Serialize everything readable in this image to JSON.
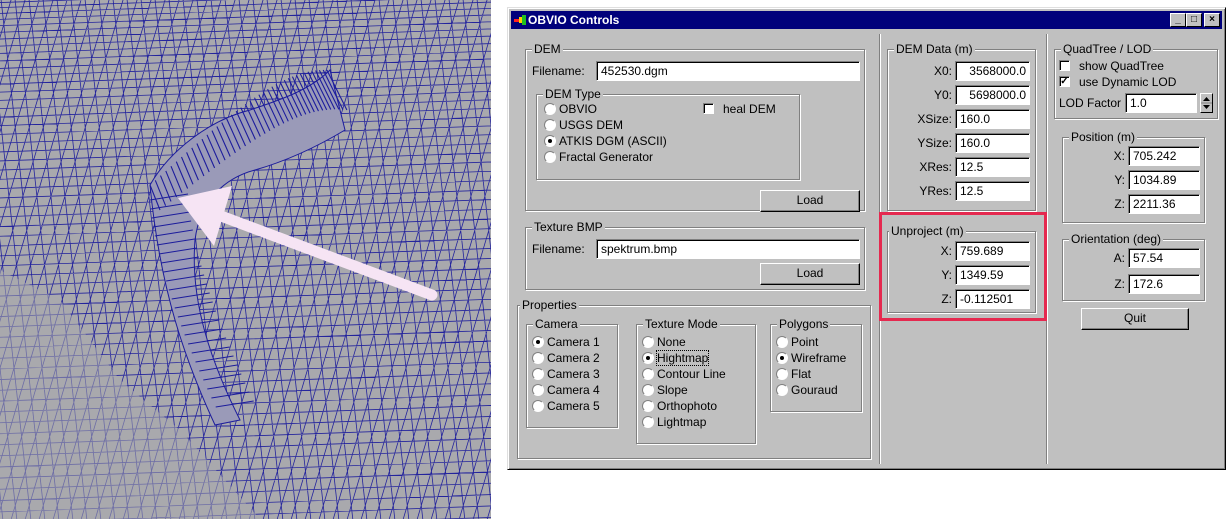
{
  "window": {
    "title": "OBVIO Controls",
    "minimize": "_",
    "maximize": "□",
    "close": "×"
  },
  "dem": {
    "group_label": "DEM",
    "filename_label": "Filename:",
    "filename": "452530.dgm",
    "type_group_label": "DEM Type",
    "types": [
      "OBVIO",
      "USGS DEM",
      "ATKIS DGM (ASCII)",
      "Fractal Generator"
    ],
    "selected_type": "ATKIS DGM (ASCII)",
    "heal_label": "heal DEM",
    "heal_checked": false,
    "load_label": "Load"
  },
  "texture": {
    "group_label": "Texture BMP",
    "filename_label": "Filename:",
    "filename": "spektrum.bmp",
    "load_label": "Load"
  },
  "properties": {
    "group_label": "Properties",
    "camera": {
      "label": "Camera",
      "options": [
        "Camera 1",
        "Camera 2",
        "Camera 3",
        "Camera 4",
        "Camera 5"
      ],
      "selected": "Camera 1"
    },
    "texture_mode": {
      "label": "Texture Mode",
      "options": [
        "None",
        "Hightmap",
        "Contour Line",
        "Slope",
        "Orthophoto",
        "Lightmap"
      ],
      "selected": "Hightmap"
    },
    "polygons": {
      "label": "Polygons",
      "options": [
        "Point",
        "Wireframe",
        "Flat",
        "Gouraud"
      ],
      "selected": "Wireframe"
    }
  },
  "dem_data": {
    "group_label": "DEM Data (m)",
    "fields": [
      {
        "label": "X0:",
        "value": "3568000.0"
      },
      {
        "label": "Y0:",
        "value": "5698000.0"
      },
      {
        "label": "XSize:",
        "value": "160.0"
      },
      {
        "label": "YSize:",
        "value": "160.0"
      },
      {
        "label": "XRes:",
        "value": "12.5"
      },
      {
        "label": "YRes:",
        "value": "12.5"
      }
    ]
  },
  "unproject": {
    "group_label": "Unproject (m)",
    "fields": [
      {
        "label": "X:",
        "value": "759.689"
      },
      {
        "label": "Y:",
        "value": "1349.59"
      },
      {
        "label": "Z:",
        "value": "-0.112501"
      }
    ],
    "highlight_color": "#e5294f"
  },
  "quadtree": {
    "group_label": "QuadTree / LOD",
    "show_label": "show QuadTree",
    "show_checked": false,
    "dynamic_label": "use Dynamic LOD",
    "dynamic_checked": true,
    "lod_label": "LOD Factor",
    "lod_value": "1.0"
  },
  "position": {
    "group_label": "Position (m)",
    "fields": [
      {
        "label": "X:",
        "value": "705.242"
      },
      {
        "label": "Y:",
        "value": "1034.89"
      },
      {
        "label": "Z:",
        "value": "2211.36"
      }
    ]
  },
  "orientation": {
    "group_label": "Orientation (deg)",
    "fields": [
      {
        "label": "A:",
        "value": "57.54"
      },
      {
        "label": "Z:",
        "value": "172.6"
      }
    ]
  },
  "quit_label": "Quit",
  "colors": {
    "wire": "#1c1c9c",
    "surface": "#a9a9ad",
    "arrow": "#f6e4f4",
    "title_bar": "#00007b",
    "dialog": "#c0c0c0"
  }
}
